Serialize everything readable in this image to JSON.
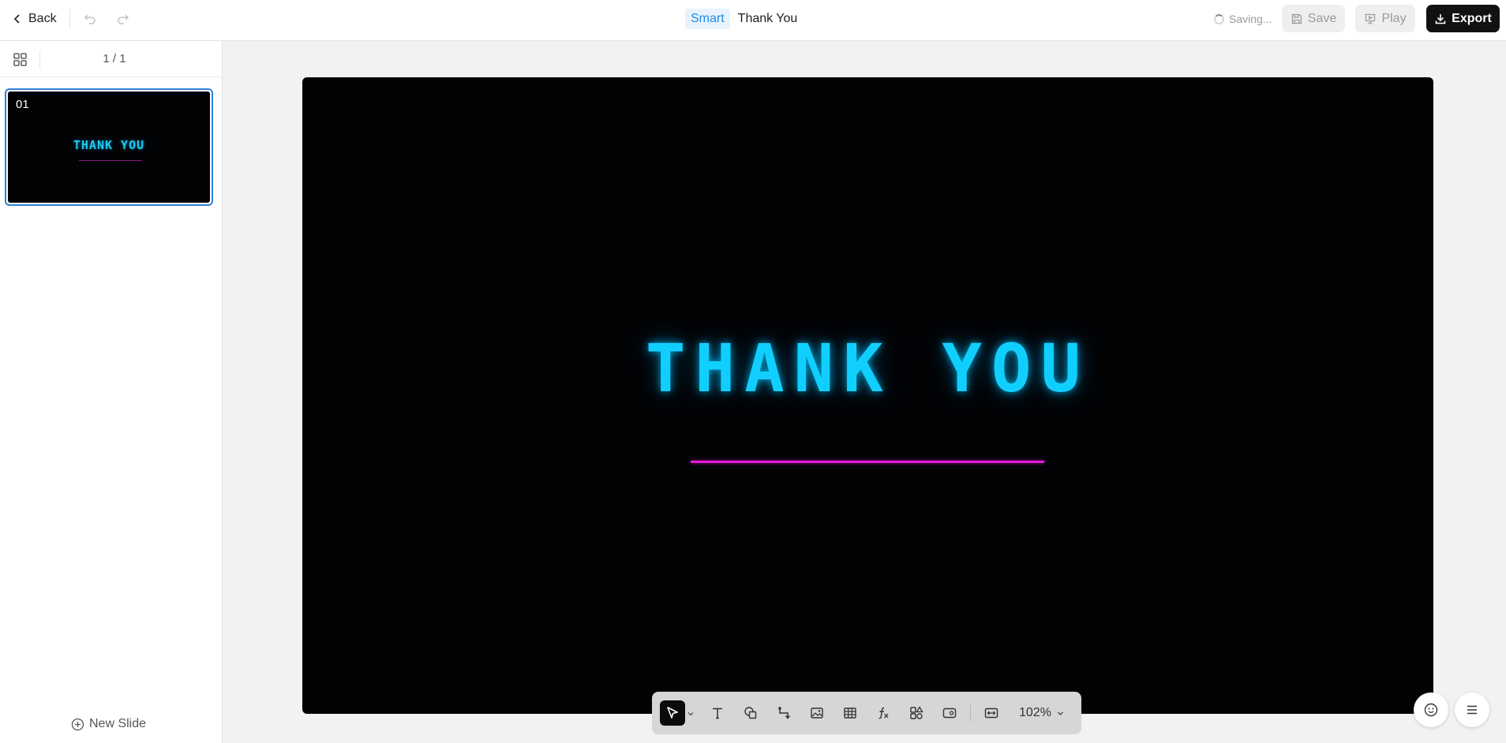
{
  "header": {
    "back_label": "Back",
    "badge": "Smart",
    "title": "Thank You",
    "status": "Saving...",
    "save_label": "Save",
    "play_label": "Play",
    "export_label": "Export"
  },
  "sidebar": {
    "page_indicator": "1 / 1",
    "slides": [
      {
        "number": "01",
        "title": "THANK YOU"
      }
    ],
    "new_slide_label": "New Slide"
  },
  "slide": {
    "title": "THANK YOU",
    "title_color": "#10cfff",
    "line_color": "#e31ad6",
    "background": "#020305"
  },
  "toolbar": {
    "tools": [
      "select-icon",
      "text-icon",
      "shapes-icon",
      "connector-icon",
      "image-icon",
      "table-icon",
      "formula-icon",
      "components-icon",
      "media-icon",
      "fit-width-icon"
    ],
    "zoom": "102%"
  },
  "floating": {
    "icons": [
      "emoji-icon",
      "menu-icon"
    ]
  },
  "colors": {
    "accent": "#1f8ce6",
    "export_bg": "#111111"
  }
}
